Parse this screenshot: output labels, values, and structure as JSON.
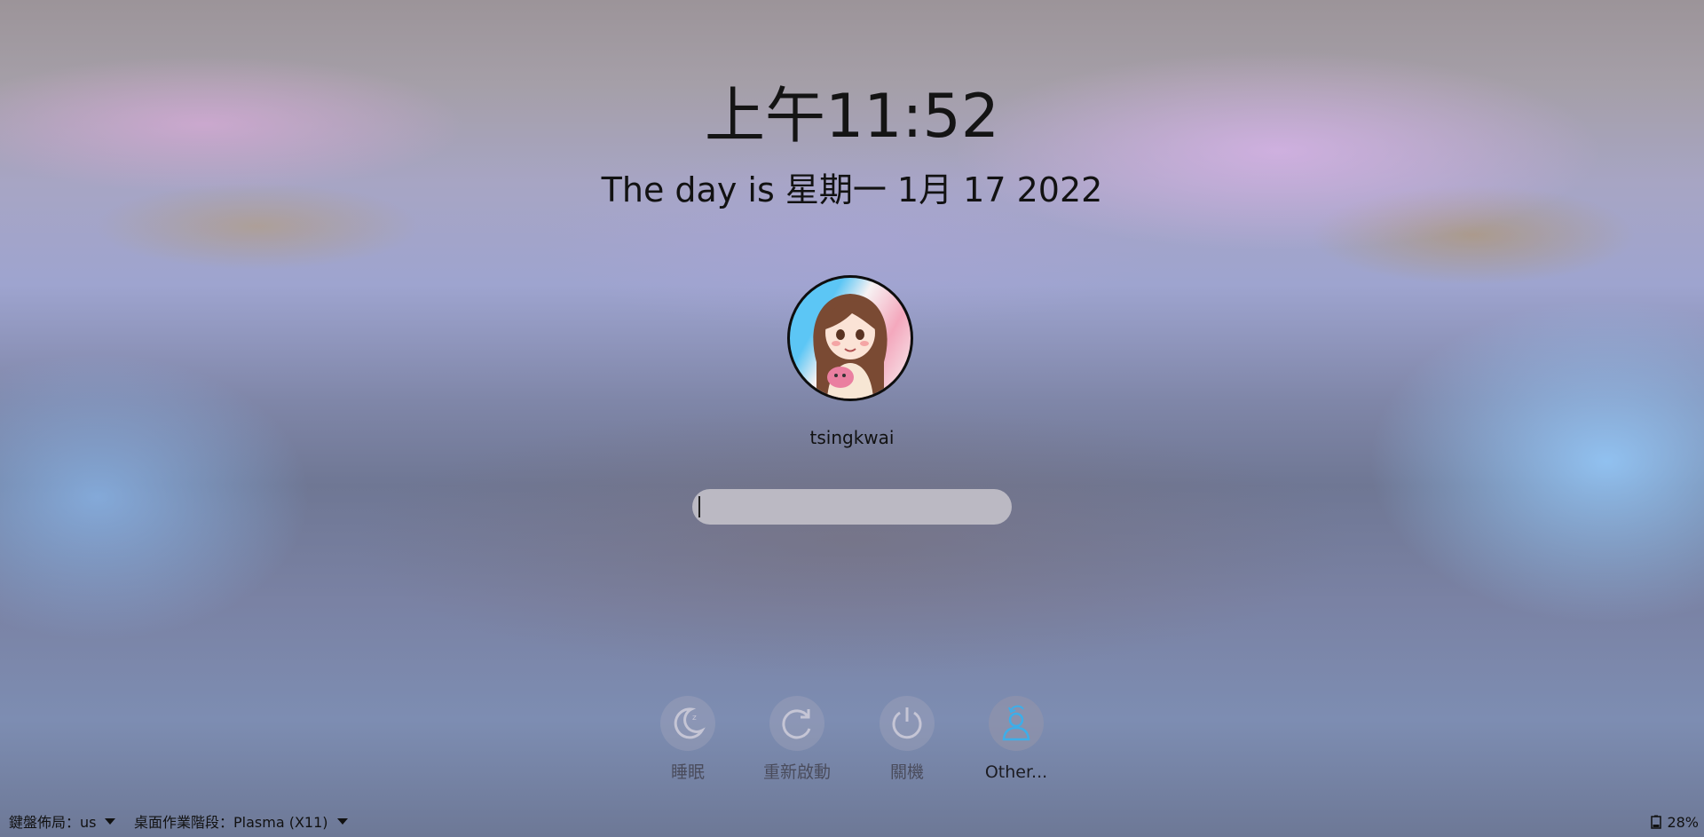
{
  "lock_screen": {
    "time": "上午11:52",
    "date_text": "The day is 星期一 1月 17 2022",
    "user": {
      "name": "tsingkwai",
      "avatar_icon": "user-avatar"
    },
    "password": {
      "value": "",
      "placeholder": ""
    }
  },
  "actions": [
    {
      "label": "睡眠",
      "icon": "sleep-icon",
      "active": false
    },
    {
      "label": "重新啟動",
      "icon": "restart-icon",
      "active": false
    },
    {
      "label": "關機",
      "icon": "power-icon",
      "active": false
    },
    {
      "label": "Other...",
      "icon": "switch-user-icon",
      "active": true
    }
  ],
  "bottom_bar": {
    "keyboard_layout": "鍵盤佈局：us",
    "session": "桌面作業階段：Plasma (X11)",
    "battery": "28%"
  },
  "colors": {
    "text_primary": "#141414",
    "accent_blue": "#3daee9",
    "field_bg": "#c8c6cd"
  }
}
